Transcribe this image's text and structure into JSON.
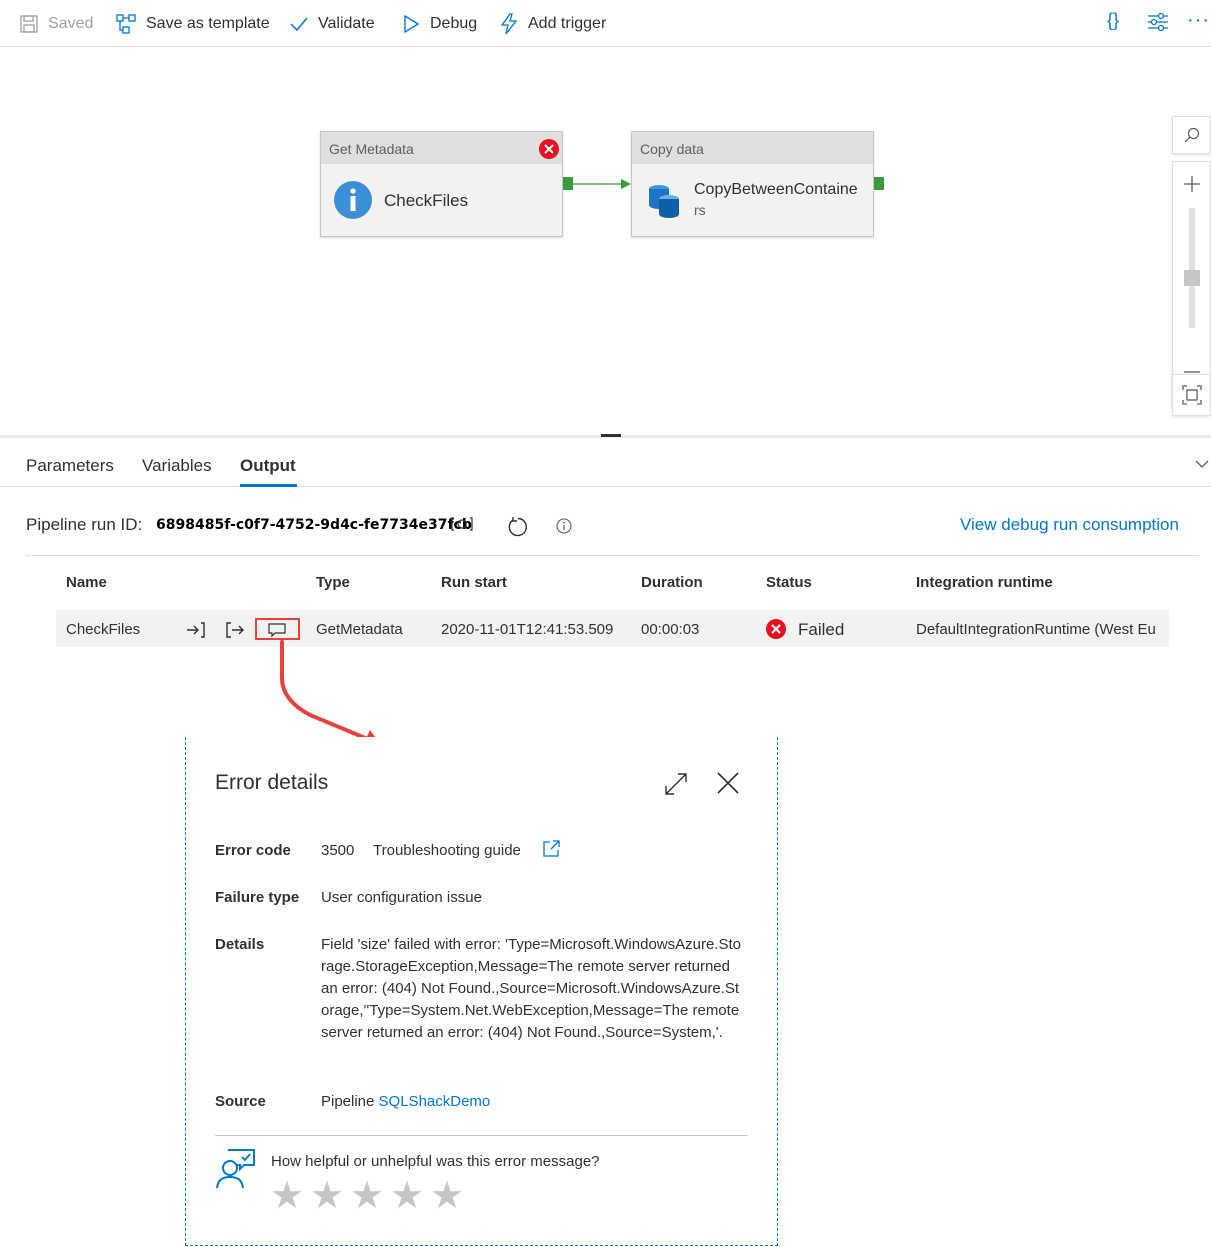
{
  "toolbar": {
    "saved_label": "Saved",
    "save_template_label": "Save as template",
    "validate_label": "Validate",
    "debug_label": "Debug",
    "add_trigger_label": "Add trigger",
    "code_label": "{}",
    "more_label": "···"
  },
  "canvas": {
    "activities": [
      {
        "type_label": "Get Metadata",
        "name": "CheckFiles",
        "status": "error"
      },
      {
        "type_label": "Copy data",
        "name_line1": "CopyBetweenContaine",
        "name_line2": "rs"
      }
    ]
  },
  "tabs": [
    {
      "label": "Parameters"
    },
    {
      "label": "Variables"
    },
    {
      "label": "Output",
      "active": true
    }
  ],
  "output": {
    "run_id_label": "Pipeline run ID:",
    "run_id": "6898485f-c0f7-4752-9d4c-fe7734e37fcb",
    "view_consumption": "View debug run consumption",
    "columns": [
      "Name",
      "Type",
      "Run start",
      "Duration",
      "Status",
      "Integration runtime"
    ],
    "rows": [
      {
        "name": "CheckFiles",
        "type": "GetMetadata",
        "run_start": "2020-11-01T12:41:53.509",
        "duration": "00:00:03",
        "status": "Failed",
        "runtime": "DefaultIntegrationRuntime (West Eu"
      }
    ]
  },
  "error_panel": {
    "title": "Error details",
    "error_code_label": "Error code",
    "error_code": "3500",
    "troubleshooting": "Troubleshooting guide",
    "failure_type_label": "Failure type",
    "failure_type": "User configuration issue",
    "details_label": "Details",
    "details": "Field 'size' failed with error: 'Type=Microsoft.WindowsAzure.Storage.StorageException,Message=The remote server returned an error: (404) Not Found.,Source=Microsoft.WindowsAzure.Storage,''Type=System.Net.WebException,Message=The remote server returned an error: (404) Not Found.,Source=System,'.",
    "source_label": "Source",
    "source_prefix": "Pipeline",
    "source_link": "SQLShackDemo",
    "feedback_question": "How helpful or unhelpful was this error message?",
    "rating_max": 5,
    "rating_value": 0
  },
  "colors": {
    "accent": "#0078d4",
    "error": "#e81123",
    "annotation": "#e8423f"
  }
}
